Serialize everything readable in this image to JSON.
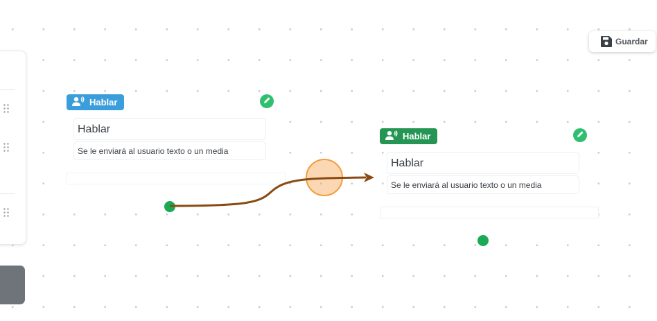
{
  "toolbar": {
    "save_label": "Guardar",
    "save_icon": "floppy-disk-icon"
  },
  "nodes": [
    {
      "badge_label": "Hablar",
      "badge_color": "#3a9ddc",
      "badge_icon": "user-speaking-icon",
      "edit_icon": "pencil-icon",
      "title": "Hablar",
      "description": "Se le enviará al usuario texto o un media"
    },
    {
      "badge_label": "Hablar",
      "badge_color": "#249553",
      "badge_icon": "user-speaking-icon",
      "edit_icon": "pencil-icon",
      "title": "Hablar",
      "description": "Se le enviará al usuario texto o un media"
    }
  ],
  "colors": {
    "edge": "#8a4a13",
    "drop_target": "#f6a14a",
    "handle": "#1aaa55",
    "edit_button": "#2fbf6f"
  }
}
